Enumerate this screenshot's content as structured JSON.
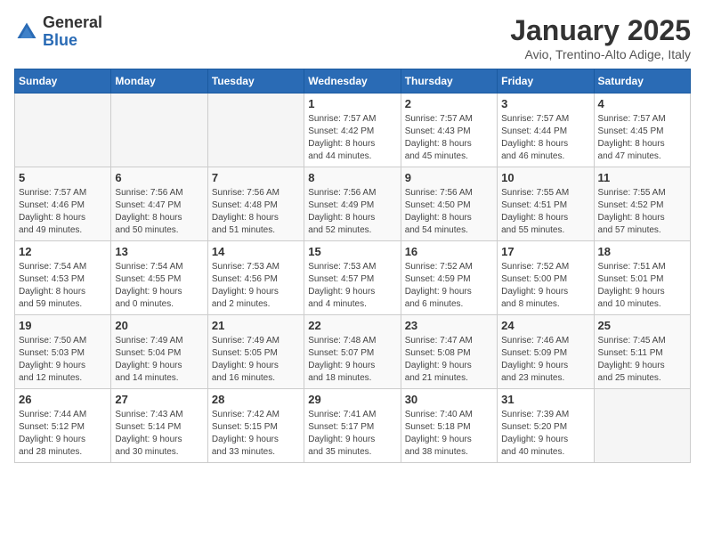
{
  "logo": {
    "general": "General",
    "blue": "Blue"
  },
  "title": "January 2025",
  "subtitle": "Avio, Trentino-Alto Adige, Italy",
  "weekdays": [
    "Sunday",
    "Monday",
    "Tuesday",
    "Wednesday",
    "Thursday",
    "Friday",
    "Saturday"
  ],
  "weeks": [
    [
      {
        "day": "",
        "info": ""
      },
      {
        "day": "",
        "info": ""
      },
      {
        "day": "",
        "info": ""
      },
      {
        "day": "1",
        "info": "Sunrise: 7:57 AM\nSunset: 4:42 PM\nDaylight: 8 hours\nand 44 minutes."
      },
      {
        "day": "2",
        "info": "Sunrise: 7:57 AM\nSunset: 4:43 PM\nDaylight: 8 hours\nand 45 minutes."
      },
      {
        "day": "3",
        "info": "Sunrise: 7:57 AM\nSunset: 4:44 PM\nDaylight: 8 hours\nand 46 minutes."
      },
      {
        "day": "4",
        "info": "Sunrise: 7:57 AM\nSunset: 4:45 PM\nDaylight: 8 hours\nand 47 minutes."
      }
    ],
    [
      {
        "day": "5",
        "info": "Sunrise: 7:57 AM\nSunset: 4:46 PM\nDaylight: 8 hours\nand 49 minutes."
      },
      {
        "day": "6",
        "info": "Sunrise: 7:56 AM\nSunset: 4:47 PM\nDaylight: 8 hours\nand 50 minutes."
      },
      {
        "day": "7",
        "info": "Sunrise: 7:56 AM\nSunset: 4:48 PM\nDaylight: 8 hours\nand 51 minutes."
      },
      {
        "day": "8",
        "info": "Sunrise: 7:56 AM\nSunset: 4:49 PM\nDaylight: 8 hours\nand 52 minutes."
      },
      {
        "day": "9",
        "info": "Sunrise: 7:56 AM\nSunset: 4:50 PM\nDaylight: 8 hours\nand 54 minutes."
      },
      {
        "day": "10",
        "info": "Sunrise: 7:55 AM\nSunset: 4:51 PM\nDaylight: 8 hours\nand 55 minutes."
      },
      {
        "day": "11",
        "info": "Sunrise: 7:55 AM\nSunset: 4:52 PM\nDaylight: 8 hours\nand 57 minutes."
      }
    ],
    [
      {
        "day": "12",
        "info": "Sunrise: 7:54 AM\nSunset: 4:53 PM\nDaylight: 8 hours\nand 59 minutes."
      },
      {
        "day": "13",
        "info": "Sunrise: 7:54 AM\nSunset: 4:55 PM\nDaylight: 9 hours\nand 0 minutes."
      },
      {
        "day": "14",
        "info": "Sunrise: 7:53 AM\nSunset: 4:56 PM\nDaylight: 9 hours\nand 2 minutes."
      },
      {
        "day": "15",
        "info": "Sunrise: 7:53 AM\nSunset: 4:57 PM\nDaylight: 9 hours\nand 4 minutes."
      },
      {
        "day": "16",
        "info": "Sunrise: 7:52 AM\nSunset: 4:59 PM\nDaylight: 9 hours\nand 6 minutes."
      },
      {
        "day": "17",
        "info": "Sunrise: 7:52 AM\nSunset: 5:00 PM\nDaylight: 9 hours\nand 8 minutes."
      },
      {
        "day": "18",
        "info": "Sunrise: 7:51 AM\nSunset: 5:01 PM\nDaylight: 9 hours\nand 10 minutes."
      }
    ],
    [
      {
        "day": "19",
        "info": "Sunrise: 7:50 AM\nSunset: 5:03 PM\nDaylight: 9 hours\nand 12 minutes."
      },
      {
        "day": "20",
        "info": "Sunrise: 7:49 AM\nSunset: 5:04 PM\nDaylight: 9 hours\nand 14 minutes."
      },
      {
        "day": "21",
        "info": "Sunrise: 7:49 AM\nSunset: 5:05 PM\nDaylight: 9 hours\nand 16 minutes."
      },
      {
        "day": "22",
        "info": "Sunrise: 7:48 AM\nSunset: 5:07 PM\nDaylight: 9 hours\nand 18 minutes."
      },
      {
        "day": "23",
        "info": "Sunrise: 7:47 AM\nSunset: 5:08 PM\nDaylight: 9 hours\nand 21 minutes."
      },
      {
        "day": "24",
        "info": "Sunrise: 7:46 AM\nSunset: 5:09 PM\nDaylight: 9 hours\nand 23 minutes."
      },
      {
        "day": "25",
        "info": "Sunrise: 7:45 AM\nSunset: 5:11 PM\nDaylight: 9 hours\nand 25 minutes."
      }
    ],
    [
      {
        "day": "26",
        "info": "Sunrise: 7:44 AM\nSunset: 5:12 PM\nDaylight: 9 hours\nand 28 minutes."
      },
      {
        "day": "27",
        "info": "Sunrise: 7:43 AM\nSunset: 5:14 PM\nDaylight: 9 hours\nand 30 minutes."
      },
      {
        "day": "28",
        "info": "Sunrise: 7:42 AM\nSunset: 5:15 PM\nDaylight: 9 hours\nand 33 minutes."
      },
      {
        "day": "29",
        "info": "Sunrise: 7:41 AM\nSunset: 5:17 PM\nDaylight: 9 hours\nand 35 minutes."
      },
      {
        "day": "30",
        "info": "Sunrise: 7:40 AM\nSunset: 5:18 PM\nDaylight: 9 hours\nand 38 minutes."
      },
      {
        "day": "31",
        "info": "Sunrise: 7:39 AM\nSunset: 5:20 PM\nDaylight: 9 hours\nand 40 minutes."
      },
      {
        "day": "",
        "info": ""
      }
    ]
  ]
}
